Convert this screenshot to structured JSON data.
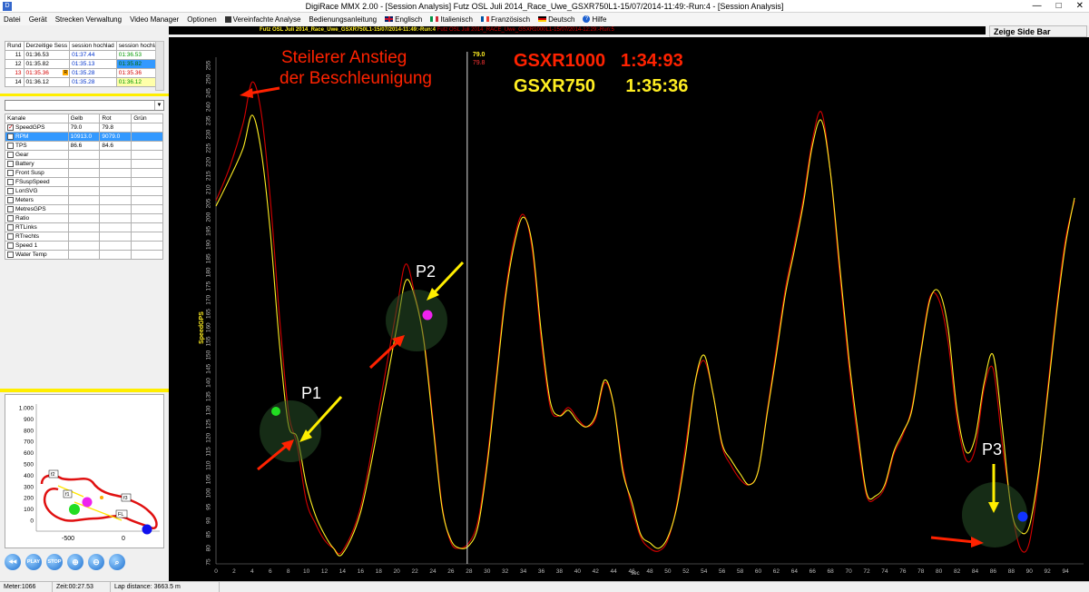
{
  "window": {
    "title": "DigiRace MMX 2.00 - [Session Analysis]   Futz OSL Juli 2014_Race_Uwe_GSXR750L1-15/07/2014-11:49:-Run:4 - [Session Analysis]",
    "minimize": "—",
    "maximize": "□",
    "close": "✕"
  },
  "menu": [
    "Datei",
    "Gerät",
    "Strecken Verwaltung",
    "Video Manager",
    "Optionen",
    "Vereinfachte Analyse",
    "Bedienungsanleitung",
    "Englisch",
    "Italienisch",
    "Französisch",
    "Deutsch",
    "Hilfe"
  ],
  "session_bar": {
    "primary": "Futz OSL Juli 2014_Race_Uwe_GSXR750L1-15/07/2014-11:49:-Run:4",
    "secondary": "Futz OSL Juli 2014_RACE_Uwe_GSXR1000L1-15/07/2014-12:29:-Run:5"
  },
  "side_bar_label": "Zeige Side Bar",
  "laps": {
    "headers": [
      "Rund",
      "Derzeitige Sess",
      "session hochlad",
      "session hochlad"
    ],
    "rows": [
      {
        "n": "11",
        "a": "01:36.53",
        "b": "01:37.44",
        "c": "01:36.53",
        "mark": ""
      },
      {
        "n": "12",
        "a": "01:35.82",
        "b": "01:35.13",
        "c": "01:35.82",
        "mark": ""
      },
      {
        "n": "13",
        "a": "01:35.36",
        "b": "01:35.28",
        "c": "01:35.36",
        "mark": "R"
      },
      {
        "n": "14",
        "a": "01:36.12",
        "b": "01:35.28",
        "c": "01:36.12",
        "mark": ""
      }
    ]
  },
  "channels": {
    "headers": [
      "Kanale",
      "Gelb",
      "Rot",
      "Grün"
    ],
    "rows": [
      {
        "name": "SpeedGPS",
        "gelb": "79.0",
        "rot": "79.8",
        "checked": true
      },
      {
        "name": "RPM",
        "gelb": "10913.0",
        "rot": "9079.0",
        "checked": false
      },
      {
        "name": "TPS",
        "gelb": "86.6",
        "rot": "84.6",
        "checked": false
      },
      {
        "name": "Gear",
        "gelb": "",
        "rot": "",
        "checked": false
      },
      {
        "name": "Battery",
        "gelb": "",
        "rot": "",
        "checked": false
      },
      {
        "name": "Front Susp",
        "gelb": "",
        "rot": "",
        "checked": false
      },
      {
        "name": "FSuspSpeed",
        "gelb": "",
        "rot": "",
        "checked": false
      },
      {
        "name": "LonSVG",
        "gelb": "",
        "rot": "",
        "checked": false
      },
      {
        "name": "Meters",
        "gelb": "",
        "rot": "",
        "checked": false
      },
      {
        "name": "MetresGPS",
        "gelb": "",
        "rot": "",
        "checked": false
      },
      {
        "name": "Ratio",
        "gelb": "",
        "rot": "",
        "checked": false
      },
      {
        "name": "RTLinks",
        "gelb": "",
        "rot": "",
        "checked": false
      },
      {
        "name": "RTrechts",
        "gelb": "",
        "rot": "",
        "checked": false
      },
      {
        "name": "Speed 1",
        "gelb": "",
        "rot": "",
        "checked": false
      },
      {
        "name": "Water Temp",
        "gelb": "",
        "rot": "",
        "checked": false
      }
    ]
  },
  "map": {
    "y_ticks": [
      "1.000",
      "900",
      "800",
      "700",
      "600",
      "500",
      "400",
      "300",
      "200",
      "100",
      "0"
    ],
    "x_ticks": [
      "-500",
      "0"
    ],
    "labels": [
      "f2",
      "f1",
      "f3",
      "FL"
    ]
  },
  "player": [
    "PLAY",
    "STOP"
  ],
  "colors": {
    "yellow": "#ffee22",
    "red": "#d40000",
    "annotation_red": "#ff2200"
  },
  "chart_data": {
    "type": "line",
    "ylabel": "SpeedGPS",
    "xlabel": "sec",
    "ylim": [
      75,
      258
    ],
    "xlim": [
      0,
      96
    ],
    "y_ticks": [
      75,
      80,
      85,
      90,
      95,
      100,
      105,
      110,
      115,
      120,
      125,
      130,
      135,
      140,
      145,
      150,
      155,
      160,
      165,
      170,
      175,
      180,
      185,
      190,
      195,
      200,
      205,
      210,
      215,
      220,
      225,
      230,
      235,
      240,
      245,
      250,
      255
    ],
    "x_ticks": [
      0,
      2,
      4,
      6,
      8,
      10,
      12,
      14,
      16,
      18,
      20,
      22,
      24,
      26,
      28,
      30,
      32,
      34,
      36,
      38,
      40,
      42,
      44,
      46,
      48,
      50,
      52,
      54,
      56,
      58,
      60,
      62,
      64,
      66,
      68,
      70,
      72,
      74,
      76,
      78,
      80,
      82,
      84,
      86,
      88,
      90,
      92,
      94
    ],
    "cursor_x": 27.8,
    "cursor_values": {
      "yellow": "79.0",
      "red": "79.8"
    },
    "annotations": {
      "headline": [
        "Steilerer Anstieg",
        "der Beschleunigung"
      ],
      "laptime_red": "GSXR1000   1:34:93",
      "laptime_yellow": "GSXR750      1:35:36",
      "points": [
        "P1",
        "P2",
        "P3"
      ]
    },
    "series": [
      {
        "name": "GSXR750",
        "color": "yellow",
        "points": [
          [
            0,
            204
          ],
          [
            1.5,
            214
          ],
          [
            3,
            225
          ],
          [
            4,
            237
          ],
          [
            5,
            224
          ],
          [
            6,
            195
          ],
          [
            7,
            155
          ],
          [
            8,
            125
          ],
          [
            9,
            120
          ],
          [
            10,
            103
          ],
          [
            11,
            92
          ],
          [
            12,
            85
          ],
          [
            13,
            80
          ],
          [
            14,
            78
          ],
          [
            16,
            93
          ],
          [
            18,
            125
          ],
          [
            20,
            160
          ],
          [
            21,
            177
          ],
          [
            22,
            171
          ],
          [
            23,
            155
          ],
          [
            24,
            125
          ],
          [
            25,
            95
          ],
          [
            26,
            83
          ],
          [
            27,
            80
          ],
          [
            28,
            81
          ],
          [
            29,
            88
          ],
          [
            30,
            110
          ],
          [
            31,
            140
          ],
          [
            32,
            170
          ],
          [
            33,
            190
          ],
          [
            34,
            200
          ],
          [
            35,
            190
          ],
          [
            36,
            158
          ],
          [
            37,
            133
          ],
          [
            38,
            128
          ],
          [
            39,
            130
          ],
          [
            40,
            126
          ],
          [
            41,
            124
          ],
          [
            42,
            128
          ],
          [
            43,
            141
          ],
          [
            44,
            132
          ],
          [
            45,
            108
          ],
          [
            46,
            97
          ],
          [
            47,
            85
          ],
          [
            48,
            82
          ],
          [
            49,
            80
          ],
          [
            50,
            84
          ],
          [
            51,
            95
          ],
          [
            52,
            115
          ],
          [
            53,
            140
          ],
          [
            54,
            150
          ],
          [
            55,
            136
          ],
          [
            56,
            118
          ],
          [
            57,
            112
          ],
          [
            58,
            107
          ],
          [
            59,
            103
          ],
          [
            60,
            108
          ],
          [
            61,
            129
          ],
          [
            62,
            150
          ],
          [
            63,
            172
          ],
          [
            64,
            188
          ],
          [
            65,
            205
          ],
          [
            66,
            226
          ],
          [
            67,
            235
          ],
          [
            68,
            216
          ],
          [
            69,
            183
          ],
          [
            70,
            150
          ],
          [
            71,
            123
          ],
          [
            72,
            100
          ],
          [
            73,
            99
          ],
          [
            74,
            103
          ],
          [
            75,
            115
          ],
          [
            76,
            122
          ],
          [
            77,
            130
          ],
          [
            78,
            151
          ],
          [
            79,
            170
          ],
          [
            80,
            173
          ],
          [
            81,
            160
          ],
          [
            82,
            130
          ],
          [
            83,
            115
          ],
          [
            84,
            120
          ],
          [
            85,
            140
          ],
          [
            86,
            150
          ],
          [
            87,
            124
          ],
          [
            88,
            94
          ],
          [
            89,
            86
          ],
          [
            90,
            88
          ],
          [
            91,
            107
          ],
          [
            92,
            135
          ],
          [
            93,
            165
          ],
          [
            94,
            190
          ],
          [
            95,
            207
          ]
        ]
      },
      {
        "name": "GSXR1000",
        "color": "red",
        "points": [
          [
            0,
            206
          ],
          [
            1.5,
            218
          ],
          [
            3,
            234
          ],
          [
            4,
            249
          ],
          [
            5,
            238
          ],
          [
            6,
            207
          ],
          [
            7,
            165
          ],
          [
            8,
            130
          ],
          [
            9,
            117
          ],
          [
            10,
            97
          ],
          [
            11,
            89
          ],
          [
            12,
            83
          ],
          [
            13,
            80
          ],
          [
            14,
            79
          ],
          [
            16,
            95
          ],
          [
            18,
            130
          ],
          [
            20,
            167
          ],
          [
            21,
            183
          ],
          [
            22,
            172
          ],
          [
            23,
            156
          ],
          [
            24,
            127
          ],
          [
            25,
            96
          ],
          [
            26,
            82
          ],
          [
            27,
            80
          ],
          [
            28,
            82
          ],
          [
            29,
            90
          ],
          [
            30,
            112
          ],
          [
            31,
            142
          ],
          [
            32,
            172
          ],
          [
            33,
            192
          ],
          [
            34,
            201
          ],
          [
            35,
            188
          ],
          [
            36,
            155
          ],
          [
            37,
            131
          ],
          [
            38,
            128
          ],
          [
            39,
            131
          ],
          [
            40,
            127
          ],
          [
            41,
            124
          ],
          [
            42,
            127
          ],
          [
            43,
            140
          ],
          [
            44,
            132
          ],
          [
            45,
            110
          ],
          [
            46,
            95
          ],
          [
            47,
            84
          ],
          [
            48,
            80
          ],
          [
            49,
            79
          ],
          [
            50,
            83
          ],
          [
            51,
            96
          ],
          [
            52,
            118
          ],
          [
            53,
            140
          ],
          [
            54,
            148
          ],
          [
            55,
            136
          ],
          [
            56,
            117
          ],
          [
            57,
            110
          ],
          [
            58,
            105
          ],
          [
            59,
            103
          ],
          [
            60,
            108
          ],
          [
            61,
            130
          ],
          [
            62,
            152
          ],
          [
            63,
            174
          ],
          [
            64,
            190
          ],
          [
            65,
            207
          ],
          [
            66,
            228
          ],
          [
            67,
            238
          ],
          [
            68,
            216
          ],
          [
            69,
            180
          ],
          [
            70,
            147
          ],
          [
            71,
            120
          ],
          [
            72,
            99
          ],
          [
            73,
            98
          ],
          [
            74,
            102
          ],
          [
            75,
            114
          ],
          [
            76,
            121
          ],
          [
            77,
            131
          ],
          [
            78,
            152
          ],
          [
            79,
            171
          ],
          [
            80,
            170
          ],
          [
            81,
            155
          ],
          [
            82,
            127
          ],
          [
            83,
            112
          ],
          [
            84,
            116
          ],
          [
            85,
            138
          ],
          [
            86,
            145
          ],
          [
            87,
            118
          ],
          [
            88,
            95
          ],
          [
            89,
            80
          ],
          [
            90,
            82
          ],
          [
            91,
            105
          ],
          [
            92,
            137
          ],
          [
            93,
            167
          ],
          [
            94,
            192
          ],
          [
            95,
            206
          ]
        ]
      }
    ]
  },
  "status": {
    "meter": "Meter:1066",
    "zeit": "Zeit:00:27.53",
    "lap": "Lap distance: 3663.5 m"
  }
}
